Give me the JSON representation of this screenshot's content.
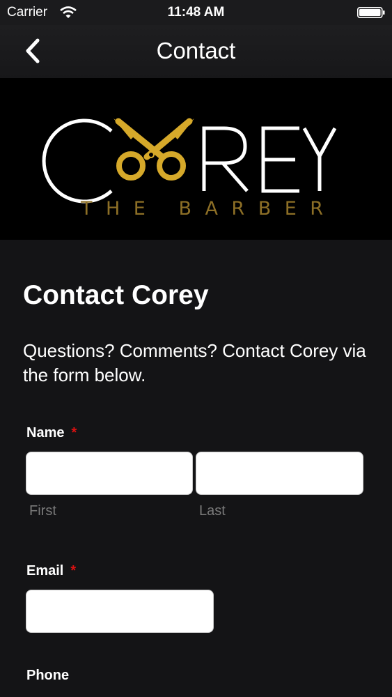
{
  "status_bar": {
    "carrier": "Carrier",
    "time": "11:48 AM"
  },
  "nav": {
    "title": "Contact"
  },
  "banner": {
    "logo_text": "COREY",
    "tagline": "THE BARBER",
    "gold": "#d6a92a"
  },
  "content": {
    "heading": "Contact Corey",
    "intro": "Questions? Comments? Contact Corey via the form below."
  },
  "form": {
    "name": {
      "label": "Name",
      "required": "*",
      "first": {
        "value": "",
        "sub": "First"
      },
      "last": {
        "value": "",
        "sub": "Last"
      }
    },
    "email": {
      "label": "Email",
      "required": "*",
      "value": ""
    },
    "phone": {
      "label": "Phone"
    }
  }
}
